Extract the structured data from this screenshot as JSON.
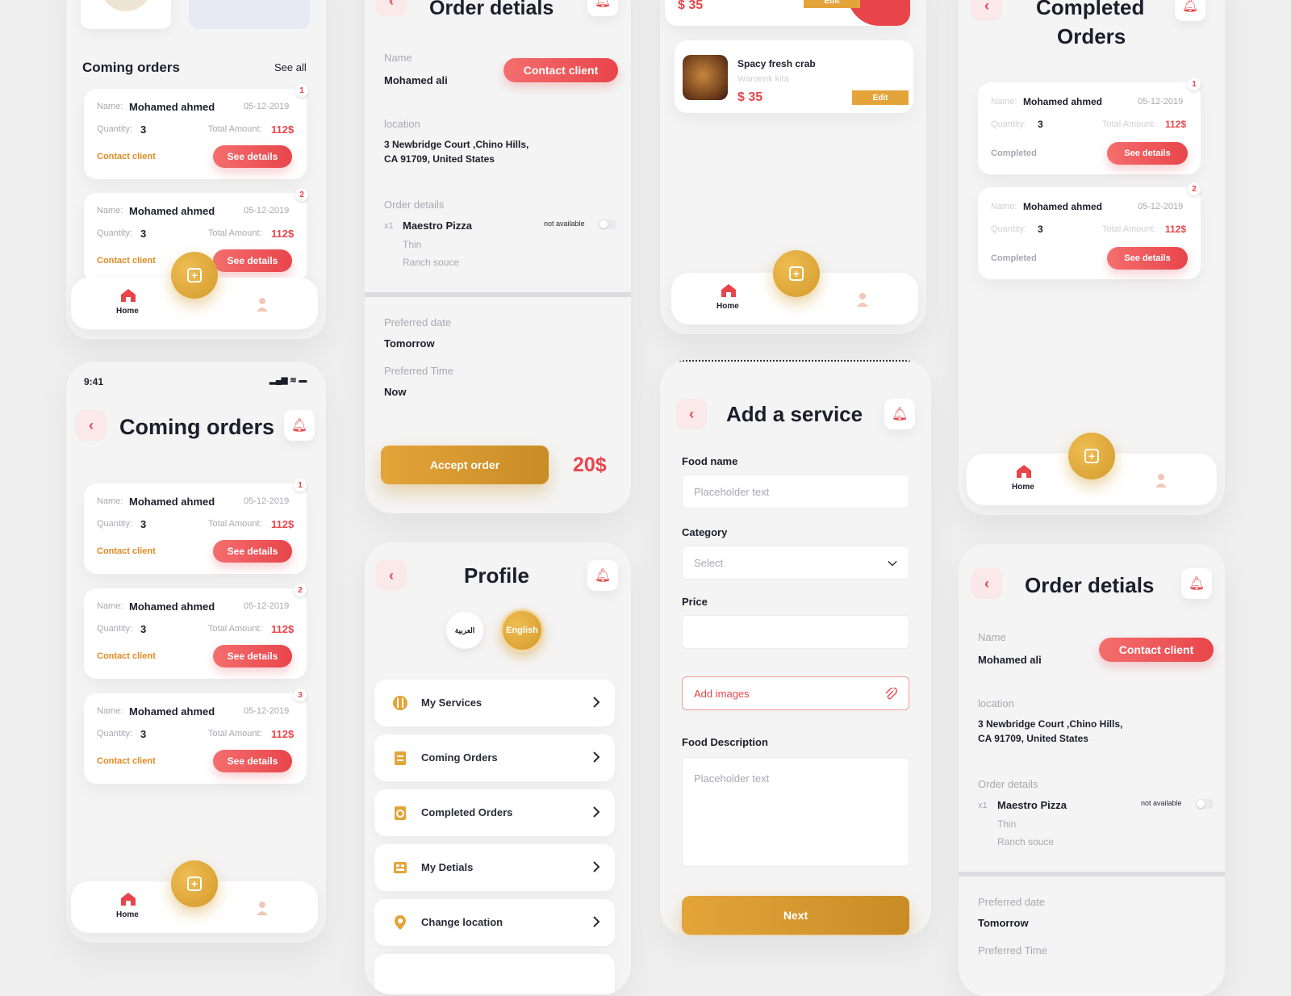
{
  "order": {
    "name_label": "Name:",
    "name": "Mohamed ahmed",
    "date": "05-12-2019",
    "quantity_label": "Quantity:",
    "quantity": "3",
    "total_label": "Total Amount:",
    "total": "112$",
    "contact": "Contact client",
    "details_btn": "See details",
    "completed": "Completed"
  },
  "screen1": {
    "section_title": "Coming orders",
    "see_all": "See all",
    "badges": [
      "1",
      "2"
    ]
  },
  "nav": {
    "home": "Home"
  },
  "status": {
    "time": "9:41"
  },
  "screen2": {
    "title": "Coming orders",
    "badges": [
      "1",
      "2",
      "3"
    ]
  },
  "order_details": {
    "title": "Order detials",
    "name_label": "Name",
    "name": "Mohamed ali",
    "contact_btn": "Contact client",
    "location_label": "location",
    "address_line1": "3 Newbridge Court ,Chino Hills,",
    "address_line2": "CA 91709, United States",
    "details_label": "Order details",
    "qty_prefix": "x1",
    "item": "Maestro Pizza",
    "availability": "not available",
    "option1": "Thin",
    "option2": "Ranch souce",
    "pref_date_label": "Preferred date",
    "pref_date": "Tomorrow",
    "pref_time_label": "Preferred Time",
    "pref_time": "Now",
    "accept_btn": "Accept order",
    "price": "20$"
  },
  "profile": {
    "title": "Profile",
    "lang_ar": "العربية",
    "lang_en": "English",
    "items": [
      "My Services",
      "Coming Orders",
      "Completed Orders",
      "My Detials",
      "Change location"
    ]
  },
  "services": {
    "top_price": "$ 35",
    "top_edit": "Edit",
    "item_name": "Spacy fresh crab",
    "item_sub": "Waroenk kita",
    "item_price": "$ 35",
    "edit": "Edit"
  },
  "add_service": {
    "title": "Add a service",
    "food_name_label": "Food name",
    "food_name_placeholder": "Placeholder text",
    "category_label": "Category",
    "category_placeholder": "Select",
    "price_label": "Price",
    "add_images": "Add images",
    "description_label": "Food Description",
    "description_placeholder": "Placeholder text",
    "next_btn": "Next"
  },
  "completed": {
    "title_line1": "Completed",
    "title_line2": "Orders",
    "name_label": "Name:",
    "badges": [
      "1",
      "2"
    ]
  },
  "colors": {
    "accent_red": "#e8454b",
    "accent_gold": "#d39a2c",
    "contact_orange": "#e38a22",
    "background": "#efefef"
  }
}
